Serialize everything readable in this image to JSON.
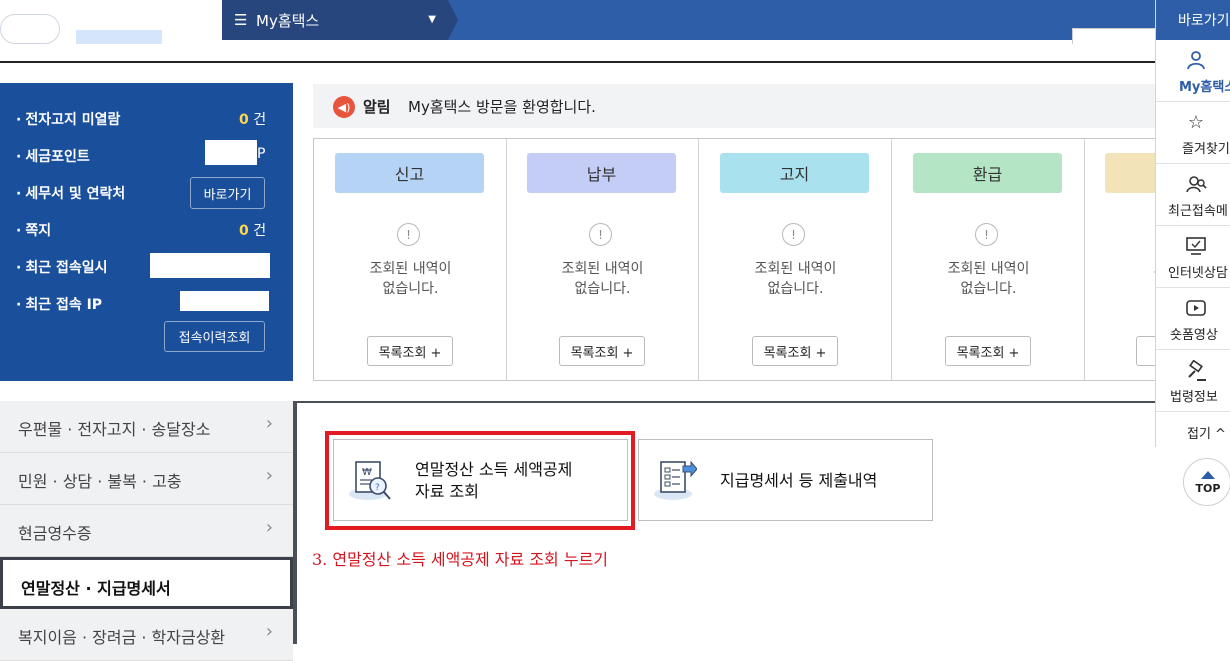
{
  "header": {
    "menu_icon": "hamburger-icon",
    "menu_label": "My홈택스",
    "dropdown_icon": "caret-down-icon"
  },
  "info_panel": {
    "rows": [
      {
        "label": "전자고지 미열람",
        "count": "0",
        "unit": "건"
      },
      {
        "label": "세금포인트",
        "suffix": "P"
      },
      {
        "label": "세무서 및 연락처",
        "button": "바로가기"
      },
      {
        "label": "쪽지",
        "count": "0",
        "unit": "건"
      },
      {
        "label": "최근 접속일시"
      },
      {
        "label": "최근 접속 IP"
      }
    ],
    "history_button": "접속이력조회"
  },
  "notice": {
    "icon": "megaphone-icon",
    "tag": "알림",
    "message": "My홈택스 방문을 환영합니다."
  },
  "cards": [
    {
      "title": "신고",
      "color": "#b5d3f5",
      "empty": [
        "조회된 내역이",
        "없습니다."
      ],
      "button": "목록조회 +"
    },
    {
      "title": "납부",
      "color": "#c4cdf6",
      "empty": [
        "조회된 내역이",
        "없습니다."
      ],
      "button": "목록조회 +"
    },
    {
      "title": "고지",
      "color": "#a9e2ee",
      "empty": [
        "조회된 내역이",
        "없습니다."
      ],
      "button": "목록조회 +"
    },
    {
      "title": "환급",
      "color": "#b4e6c6",
      "empty": [
        "조회된 내역이",
        "없습니다."
      ],
      "button": "목록조회 +"
    },
    {
      "title": "",
      "color": "#f3e3b9",
      "empty": [
        "조회",
        "없"
      ],
      "button": "목"
    }
  ],
  "left_nav": [
    {
      "label": "우편물 · 전자고지 · 송달장소"
    },
    {
      "label": "민원 · 상담 · 불복 · 고충"
    },
    {
      "label": "현금영수증"
    },
    {
      "label": "연말정산 · 지급명세서",
      "active": true
    },
    {
      "label": "복지이음 · 장려금 · 학자금상환"
    }
  ],
  "main": {
    "buttons": [
      {
        "label_line1": "연말정산 소득 세액공제",
        "label_line2": "자료 조회",
        "icon": "document-search-icon"
      },
      {
        "label_line1": "지급명세서 등 제출내역",
        "icon": "document-submit-icon"
      }
    ],
    "instruction": "3. 연말정산 소득 세액공제 자료 조회 누르기"
  },
  "quick_menu": {
    "title": "바로가기",
    "items": [
      {
        "label": "My홈택스",
        "icon": "person-icon",
        "active": true
      },
      {
        "label": "즐겨찾기",
        "icon": "star-icon"
      },
      {
        "label": "최근접속메",
        "icon": "recent-access-icon"
      },
      {
        "label": "인터넷상담",
        "icon": "monitor-chat-icon"
      },
      {
        "label": "숏폼영상",
        "icon": "play-icon"
      },
      {
        "label": "법령정보",
        "icon": "gavel-icon"
      }
    ],
    "fold_label": "접기 ^",
    "top_label": "TOP"
  },
  "colors": {
    "brand_blue": "#2e5ea8",
    "panel_blue": "#1a4f9c",
    "highlight_red": "#e21b23"
  }
}
